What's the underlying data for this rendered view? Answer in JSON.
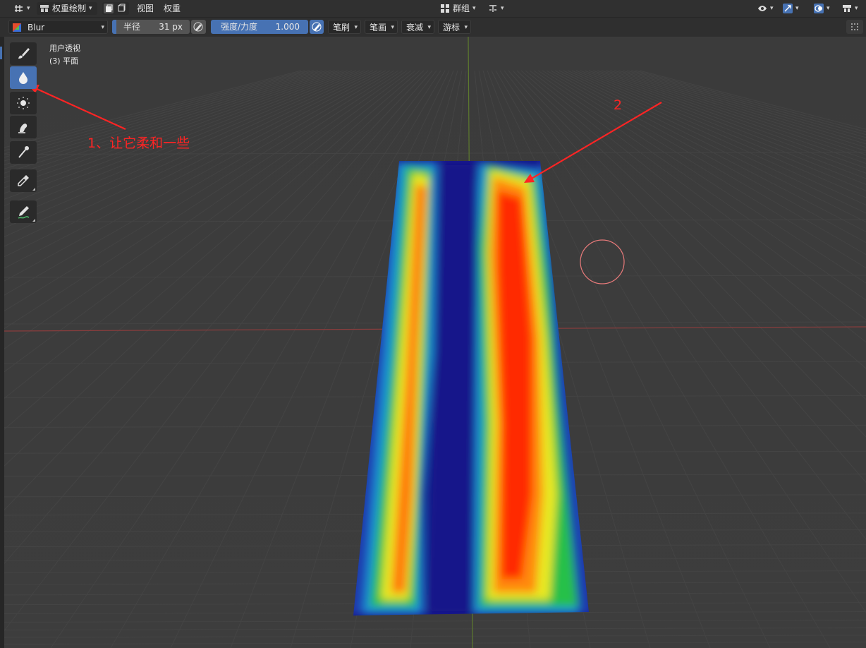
{
  "header": {
    "mode_label": "权重绘制",
    "menus": [
      "视图",
      "权重"
    ],
    "group_label": "群组"
  },
  "tool_settings": {
    "brush_name": "Blur",
    "radius": {
      "label": "半径",
      "value": "31 px"
    },
    "strength": {
      "label": "强度/力度",
      "value": "1.000"
    },
    "dropdowns": [
      "笔刷",
      "笔画",
      "衰减",
      "游标"
    ]
  },
  "viewport": {
    "view_name": "用户透视",
    "object_name": "(3) 平面"
  },
  "toolbar": {
    "tools": [
      "draw",
      "blur",
      "average",
      "smear",
      "gradient",
      "sample-weight",
      "annotate"
    ],
    "active_tool": "blur"
  },
  "annotations": {
    "note_1": "1、让它柔和一些",
    "note_2": "2",
    "color": "#ff2424"
  },
  "colors": {
    "accent": "#4772b3",
    "weight_blue": "#16168a",
    "weight_red": "#ff2a00"
  }
}
